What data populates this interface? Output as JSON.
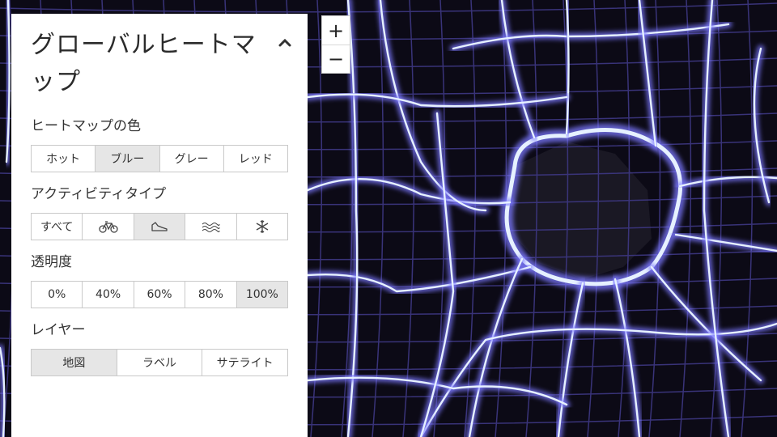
{
  "panel": {
    "title": "グローバルヒートマップ",
    "collapse_icon": "chevron-up-icon",
    "sections": {
      "color": {
        "label": "ヒートマップの色",
        "options": [
          "ホット",
          "ブルー",
          "グレー",
          "レッド"
        ],
        "selected": "ブルー"
      },
      "activity": {
        "label": "アクティビティタイプ",
        "options": [
          {
            "text": "すべて",
            "icon": ""
          },
          {
            "text": "",
            "icon": "bicycle-icon"
          },
          {
            "text": "",
            "icon": "running-shoe-icon"
          },
          {
            "text": "",
            "icon": "water-waves-icon"
          },
          {
            "text": "",
            "icon": "snowflake-icon"
          }
        ],
        "selected_index": 2
      },
      "opacity": {
        "label": "透明度",
        "options": [
          "0%",
          "40%",
          "60%",
          "80%",
          "100%"
        ],
        "selected": "100%"
      },
      "layer": {
        "label": "レイヤー",
        "options": [
          "地図",
          "ラベル",
          "サテライト"
        ],
        "selected": "地図"
      }
    }
  },
  "zoom": {
    "in_label": "+",
    "out_label": "−"
  },
  "map": {
    "heat_color": "#7b78ff",
    "core_color": "#e6f1ff",
    "background_color": "#0c0a16"
  }
}
